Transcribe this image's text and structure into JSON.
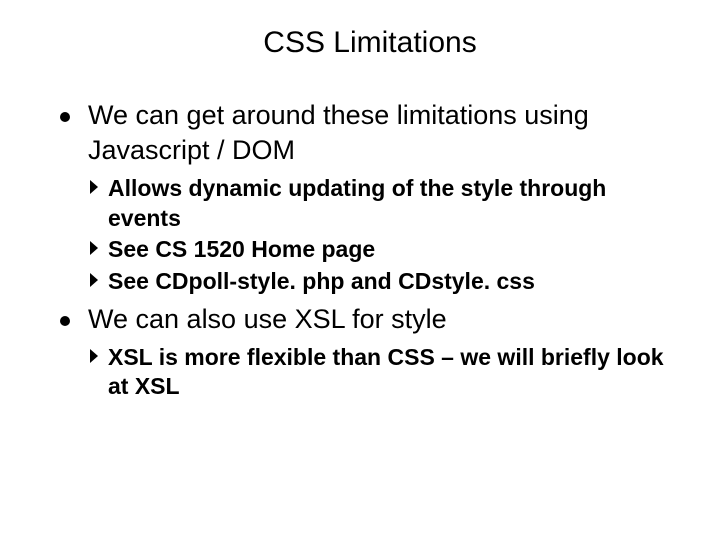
{
  "title": "CSS Limitations",
  "bullets": [
    {
      "text": "We can get around these limitations using Javascript / DOM",
      "subs": [
        "Allows dynamic updating of the style through events",
        "See CS 1520 Home page",
        "See CDpoll-style. php and CDstyle. css"
      ]
    },
    {
      "text": "We can also use XSL for style",
      "subs": [
        "XSL is more flexible than CSS – we will briefly look at XSL"
      ]
    }
  ]
}
